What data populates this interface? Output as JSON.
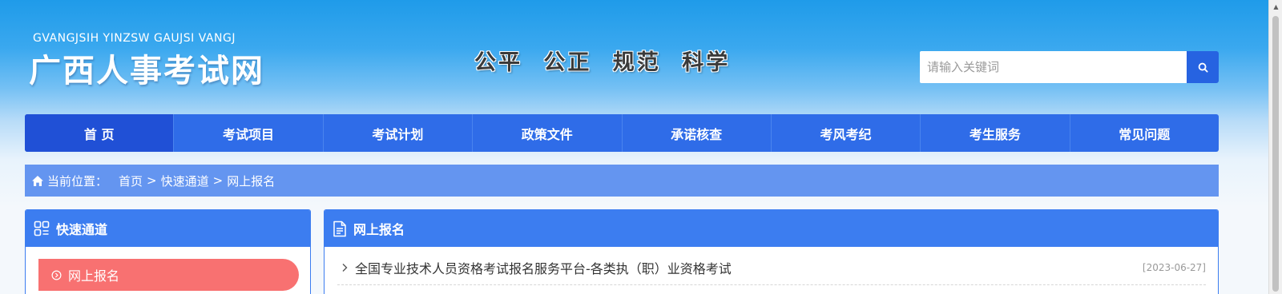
{
  "header": {
    "logo_subtitle": "GVANGJSIH YINZSW GAUJSI VANGJ",
    "logo_title": "广西人事考试网",
    "slogan": "公平  公正  规范  科学",
    "search": {
      "placeholder": "请输入关键词",
      "value": "",
      "button_icon": "search-icon"
    }
  },
  "nav": {
    "items": [
      {
        "label": "首 页",
        "active": true
      },
      {
        "label": "考试项目"
      },
      {
        "label": "考试计划"
      },
      {
        "label": "政策文件"
      },
      {
        "label": "承诺核查"
      },
      {
        "label": "考风考纪"
      },
      {
        "label": "考生服务"
      },
      {
        "label": "常见问题"
      }
    ]
  },
  "breadcrumb": {
    "icon": "home-icon",
    "label": "当前位置：",
    "items": [
      "首页",
      "快速通道",
      "网上报名"
    ],
    "separator": ">"
  },
  "sidebar": {
    "title": "快速通道",
    "title_icon": "grid-icon",
    "items": [
      {
        "label": "网上报名",
        "icon": "circle-chevron-right-icon",
        "active": true
      }
    ]
  },
  "main": {
    "title": "网上报名",
    "title_icon": "document-icon",
    "list": [
      {
        "title": "全国专业技术人员资格考试报名服务平台-各类执（职）业资格考试",
        "date": "[2023-06-27]"
      }
    ]
  },
  "colors": {
    "header_gradient_top": "#1f9be9",
    "nav_bg": "#2f6ce8",
    "nav_active": "#2050d6",
    "breadcrumb_bg": "#6495f0",
    "panel_head": "#3c7df0",
    "sidebar_active": "#f87171",
    "search_button": "#2663e1"
  }
}
